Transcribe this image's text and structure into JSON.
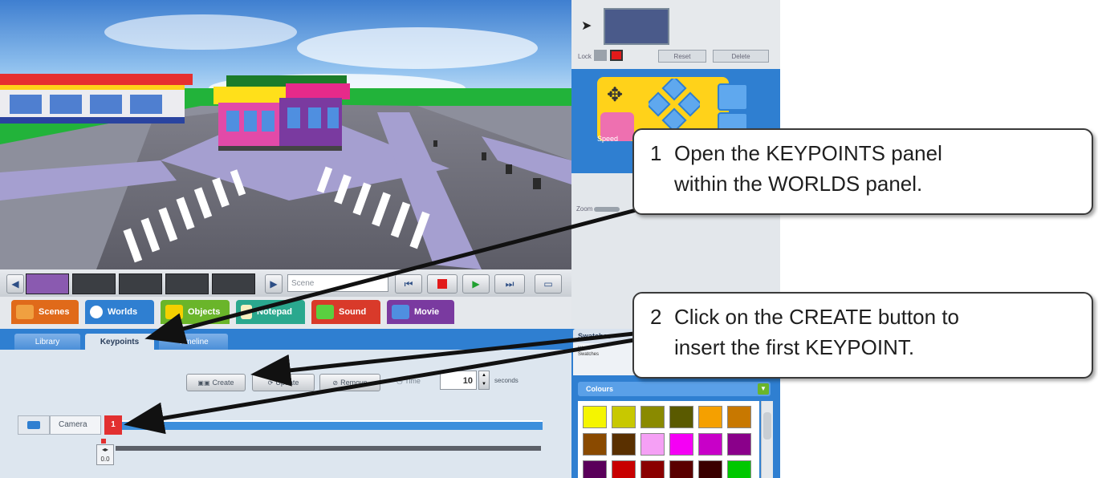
{
  "scene_name": "Scene",
  "tabs": [
    {
      "label": "Scenes",
      "color": "#e06a1a",
      "icon": "scenes-icon"
    },
    {
      "label": "Worlds",
      "color": "#2f7fd1",
      "icon": "worlds-icon"
    },
    {
      "label": "Objects",
      "color": "#6ab52a",
      "icon": "objects-icon"
    },
    {
      "label": "Notepad",
      "color": "#2aa88e",
      "icon": "notepad-icon"
    },
    {
      "label": "Sound",
      "color": "#d93a2a",
      "icon": "sound-icon"
    },
    {
      "label": "Movie",
      "color": "#7a3aa0",
      "icon": "movie-icon"
    }
  ],
  "subtabs": {
    "library": "Library",
    "keypoints": "Keypoints",
    "timeline": "Timeline"
  },
  "keypoint_buttons": {
    "create": "Create",
    "update": "Update",
    "remove": "Remove",
    "time": "Time"
  },
  "time": {
    "value": "10",
    "unit": "seconds"
  },
  "camera": {
    "label": "Camera",
    "keypoint_number": "1",
    "marker_time": "0.0"
  },
  "right_panel": {
    "lock_label": "Lock",
    "reset_label": "Reset",
    "delete_label": "Delete",
    "speed_label": "Speed",
    "zoom_label": "Zoom"
  },
  "swatches": {
    "title": "Swatches",
    "select_value": "World Swatches",
    "colours_label": "Colours",
    "colors": [
      "#f5f500",
      "#c8c800",
      "#8a8a00",
      "#5a5a00",
      "#f5a000",
      "#c87800",
      "#8a4a00",
      "#5a3000",
      "#f5a0f5",
      "#f500f5",
      "#c800c8",
      "#8a008a",
      "#5a005a",
      "#c80000",
      "#8a0000",
      "#5a0000",
      "#3a0000",
      "#00c800"
    ]
  },
  "callouts": {
    "one": {
      "num": "1",
      "line1": "Open the KEYPOINTS panel",
      "line2": "within the WORLDS panel."
    },
    "two": {
      "num": "2",
      "line1": "Click on the CREATE button to",
      "line2": "insert the first KEYPOINT."
    }
  }
}
